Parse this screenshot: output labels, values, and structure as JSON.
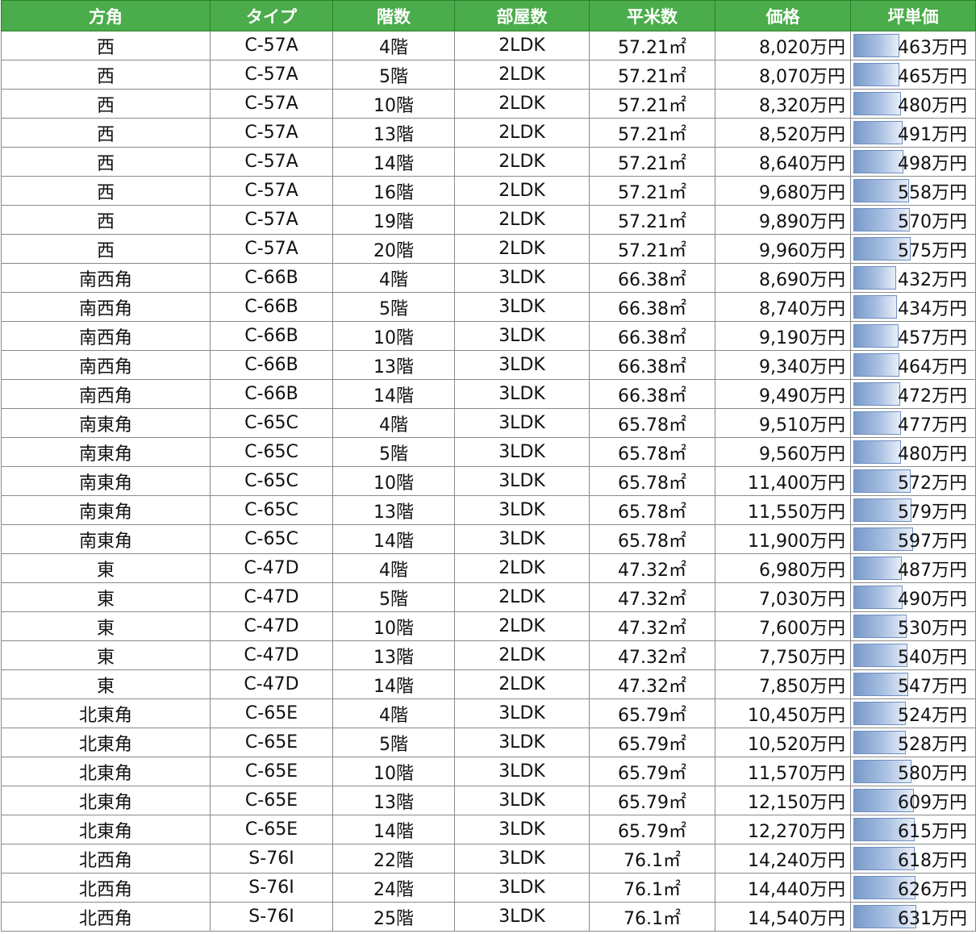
{
  "headers": [
    "方角",
    "タイプ",
    "階数",
    "部屋数",
    "平米数",
    "価格",
    "坪単価"
  ],
  "rows": [
    {
      "direction": "西",
      "type": "C-57A",
      "floor": "4階",
      "rooms": "2LDK",
      "area": "57.21㎡",
      "price": "8,020万円",
      "unit_price": "463万円",
      "unit_value": 463
    },
    {
      "direction": "西",
      "type": "C-57A",
      "floor": "5階",
      "rooms": "2LDK",
      "area": "57.21㎡",
      "price": "8,070万円",
      "unit_price": "465万円",
      "unit_value": 465
    },
    {
      "direction": "西",
      "type": "C-57A",
      "floor": "10階",
      "rooms": "2LDK",
      "area": "57.21㎡",
      "price": "8,320万円",
      "unit_price": "480万円",
      "unit_value": 480
    },
    {
      "direction": "西",
      "type": "C-57A",
      "floor": "13階",
      "rooms": "2LDK",
      "area": "57.21㎡",
      "price": "8,520万円",
      "unit_price": "491万円",
      "unit_value": 491
    },
    {
      "direction": "西",
      "type": "C-57A",
      "floor": "14階",
      "rooms": "2LDK",
      "area": "57.21㎡",
      "price": "8,640万円",
      "unit_price": "498万円",
      "unit_value": 498
    },
    {
      "direction": "西",
      "type": "C-57A",
      "floor": "16階",
      "rooms": "2LDK",
      "area": "57.21㎡",
      "price": "9,680万円",
      "unit_price": "558万円",
      "unit_value": 558
    },
    {
      "direction": "西",
      "type": "C-57A",
      "floor": "19階",
      "rooms": "2LDK",
      "area": "57.21㎡",
      "price": "9,890万円",
      "unit_price": "570万円",
      "unit_value": 570
    },
    {
      "direction": "西",
      "type": "C-57A",
      "floor": "20階",
      "rooms": "2LDK",
      "area": "57.21㎡",
      "price": "9,960万円",
      "unit_price": "575万円",
      "unit_value": 575
    },
    {
      "direction": "南西角",
      "type": "C-66B",
      "floor": "4階",
      "rooms": "3LDK",
      "area": "66.38㎡",
      "price": "8,690万円",
      "unit_price": "432万円",
      "unit_value": 432
    },
    {
      "direction": "南西角",
      "type": "C-66B",
      "floor": "5階",
      "rooms": "3LDK",
      "area": "66.38㎡",
      "price": "8,740万円",
      "unit_price": "434万円",
      "unit_value": 434
    },
    {
      "direction": "南西角",
      "type": "C-66B",
      "floor": "10階",
      "rooms": "3LDK",
      "area": "66.38㎡",
      "price": "9,190万円",
      "unit_price": "457万円",
      "unit_value": 457
    },
    {
      "direction": "南西角",
      "type": "C-66B",
      "floor": "13階",
      "rooms": "3LDK",
      "area": "66.38㎡",
      "price": "9,340万円",
      "unit_price": "464万円",
      "unit_value": 464
    },
    {
      "direction": "南西角",
      "type": "C-66B",
      "floor": "14階",
      "rooms": "3LDK",
      "area": "66.38㎡",
      "price": "9,490万円",
      "unit_price": "472万円",
      "unit_value": 472
    },
    {
      "direction": "南東角",
      "type": "C-65C",
      "floor": "4階",
      "rooms": "3LDK",
      "area": "65.78㎡",
      "price": "9,510万円",
      "unit_price": "477万円",
      "unit_value": 477
    },
    {
      "direction": "南東角",
      "type": "C-65C",
      "floor": "5階",
      "rooms": "3LDK",
      "area": "65.78㎡",
      "price": "9,560万円",
      "unit_price": "480万円",
      "unit_value": 480
    },
    {
      "direction": "南東角",
      "type": "C-65C",
      "floor": "10階",
      "rooms": "3LDK",
      "area": "65.78㎡",
      "price": "11,400万円",
      "unit_price": "572万円",
      "unit_value": 572
    },
    {
      "direction": "南東角",
      "type": "C-65C",
      "floor": "13階",
      "rooms": "3LDK",
      "area": "65.78㎡",
      "price": "11,550万円",
      "unit_price": "579万円",
      "unit_value": 579
    },
    {
      "direction": "南東角",
      "type": "C-65C",
      "floor": "14階",
      "rooms": "3LDK",
      "area": "65.78㎡",
      "price": "11,900万円",
      "unit_price": "597万円",
      "unit_value": 597
    },
    {
      "direction": "東",
      "type": "C-47D",
      "floor": "4階",
      "rooms": "2LDK",
      "area": "47.32㎡",
      "price": "6,980万円",
      "unit_price": "487万円",
      "unit_value": 487
    },
    {
      "direction": "東",
      "type": "C-47D",
      "floor": "5階",
      "rooms": "2LDK",
      "area": "47.32㎡",
      "price": "7,030万円",
      "unit_price": "490万円",
      "unit_value": 490
    },
    {
      "direction": "東",
      "type": "C-47D",
      "floor": "10階",
      "rooms": "2LDK",
      "area": "47.32㎡",
      "price": "7,600万円",
      "unit_price": "530万円",
      "unit_value": 530
    },
    {
      "direction": "東",
      "type": "C-47D",
      "floor": "13階",
      "rooms": "2LDK",
      "area": "47.32㎡",
      "price": "7,750万円",
      "unit_price": "540万円",
      "unit_value": 540
    },
    {
      "direction": "東",
      "type": "C-47D",
      "floor": "14階",
      "rooms": "2LDK",
      "area": "47.32㎡",
      "price": "7,850万円",
      "unit_price": "547万円",
      "unit_value": 547
    },
    {
      "direction": "北東角",
      "type": "C-65E",
      "floor": "4階",
      "rooms": "3LDK",
      "area": "65.79㎡",
      "price": "10,450万円",
      "unit_price": "524万円",
      "unit_value": 524
    },
    {
      "direction": "北東角",
      "type": "C-65E",
      "floor": "5階",
      "rooms": "3LDK",
      "area": "65.79㎡",
      "price": "10,520万円",
      "unit_price": "528万円",
      "unit_value": 528
    },
    {
      "direction": "北東角",
      "type": "C-65E",
      "floor": "10階",
      "rooms": "3LDK",
      "area": "65.79㎡",
      "price": "11,570万円",
      "unit_price": "580万円",
      "unit_value": 580
    },
    {
      "direction": "北東角",
      "type": "C-65E",
      "floor": "13階",
      "rooms": "3LDK",
      "area": "65.79㎡",
      "price": "12,150万円",
      "unit_price": "609万円",
      "unit_value": 609
    },
    {
      "direction": "北東角",
      "type": "C-65E",
      "floor": "14階",
      "rooms": "3LDK",
      "area": "65.79㎡",
      "price": "12,270万円",
      "unit_price": "615万円",
      "unit_value": 615
    },
    {
      "direction": "北西角",
      "type": "S-76I",
      "floor": "22階",
      "rooms": "3LDK",
      "area": "76.1㎡",
      "price": "14,240万円",
      "unit_price": "618万円",
      "unit_value": 618
    },
    {
      "direction": "北西角",
      "type": "S-76I",
      "floor": "24階",
      "rooms": "3LDK",
      "area": "76.1㎡",
      "price": "14,440万円",
      "unit_price": "626万円",
      "unit_value": 626
    },
    {
      "direction": "北西角",
      "type": "S-76I",
      "floor": "25階",
      "rooms": "3LDK",
      "area": "76.1㎡",
      "price": "14,540万円",
      "unit_price": "631万円",
      "unit_value": 631
    }
  ],
  "colors": {
    "header_bg": "#4aac4a",
    "header_text": "#ffffff",
    "databar": "#7799c9",
    "grid": "#8a8a8a"
  }
}
